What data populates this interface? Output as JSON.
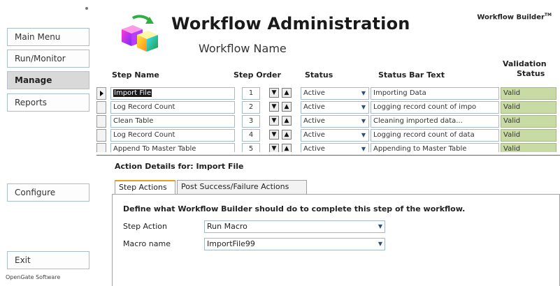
{
  "sidebar": {
    "items": [
      {
        "label": "Main Menu"
      },
      {
        "label": "Run/Monitor"
      },
      {
        "label": "Manage"
      },
      {
        "label": "Reports"
      },
      {
        "label": "Configure"
      },
      {
        "label": "Exit"
      }
    ],
    "active": "Manage",
    "company": "OpenGate Software"
  },
  "header": {
    "title": "Workflow Administration",
    "subtitle": "Workflow Name",
    "brand": "Workflow Builder",
    "brand_mark": "TM"
  },
  "grid": {
    "columns": {
      "step_name": "Step Name",
      "step_order": "Step Order",
      "status": "Status",
      "status_bar_text": "Status Bar Text",
      "validation_line1": "Validation",
      "validation_line2": "Status"
    },
    "rows": [
      {
        "name": "Import File",
        "order": "1",
        "status": "Active",
        "status_bar_text": "Importing Data",
        "validation": "Valid"
      },
      {
        "name": "Log Record Count",
        "order": "2",
        "status": "Active",
        "status_bar_text": "Logging record count of impo",
        "validation": "Valid"
      },
      {
        "name": "Clean Table",
        "order": "3",
        "status": "Active",
        "status_bar_text": "Cleaning imported data...",
        "validation": "Valid"
      },
      {
        "name": "Log Record Count",
        "order": "4",
        "status": "Active",
        "status_bar_text": "Logging record count of data",
        "validation": "Valid"
      },
      {
        "name": "Append To Master Table",
        "order": "5",
        "status": "Active",
        "status_bar_text": "Appending to Master Table",
        "validation": "Valid"
      }
    ]
  },
  "action_details": {
    "title": "Action Details for: Import File",
    "tabs": [
      {
        "label": "Step Actions"
      },
      {
        "label": "Post Success/Failure Actions"
      }
    ],
    "description": "Define what Workflow Builder should do to complete this step of the workflow.",
    "step_action_label": "Step Action",
    "step_action_value": "Run Macro",
    "macro_name_label": "Macro name",
    "macro_name_value": "ImportFile99"
  },
  "colors": {
    "valid_bg": "#c9dba4",
    "active_tab_accent": "#e3a21a",
    "sidebar_active_bg": "#d9d9d9"
  },
  "icons": [
    "workflow-cubes-icon",
    "move-down-icon",
    "move-up-icon",
    "dropdown-arrow-icon",
    "current-row-icon"
  ]
}
